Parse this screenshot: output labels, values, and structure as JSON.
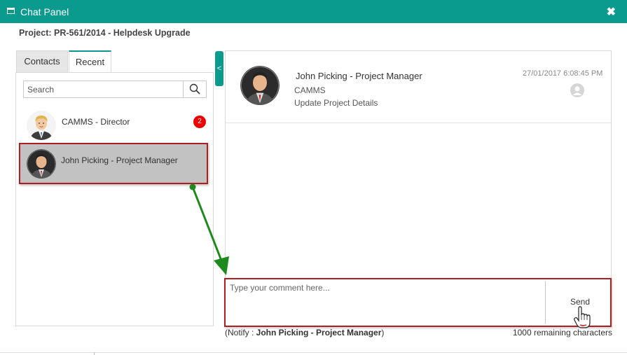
{
  "window": {
    "title": "Chat Panel",
    "close_glyph": "✖"
  },
  "project_label": "Project: PR-561/2014 - Helpdesk Upgrade",
  "tabs": [
    {
      "label": "Contacts"
    },
    {
      "label": "Recent"
    }
  ],
  "active_tab": "Recent",
  "search": {
    "placeholder": "Search"
  },
  "contacts": [
    {
      "name": "CAMMS - Director",
      "unread": "2"
    },
    {
      "name": "John Picking - Project Manager",
      "selected": true
    }
  ],
  "collapse_glyph": "<",
  "message": {
    "sender": "John Picking - Project Manager",
    "org": "CAMMS",
    "text": "Update Project Details",
    "time": "27/01/2017 6:08:45 PM"
  },
  "compose": {
    "placeholder": "Type your comment here...",
    "send_label": "Send"
  },
  "notify": {
    "prefix": "(Notify : ",
    "name": "John Picking - Project Manager",
    "suffix": ")"
  },
  "remaining": "1000 remaining characters",
  "colors": {
    "accent": "#0a9a8e",
    "highlight_border": "#b01e24",
    "arrow": "#1e8a1e",
    "badge": "#ee0000"
  }
}
